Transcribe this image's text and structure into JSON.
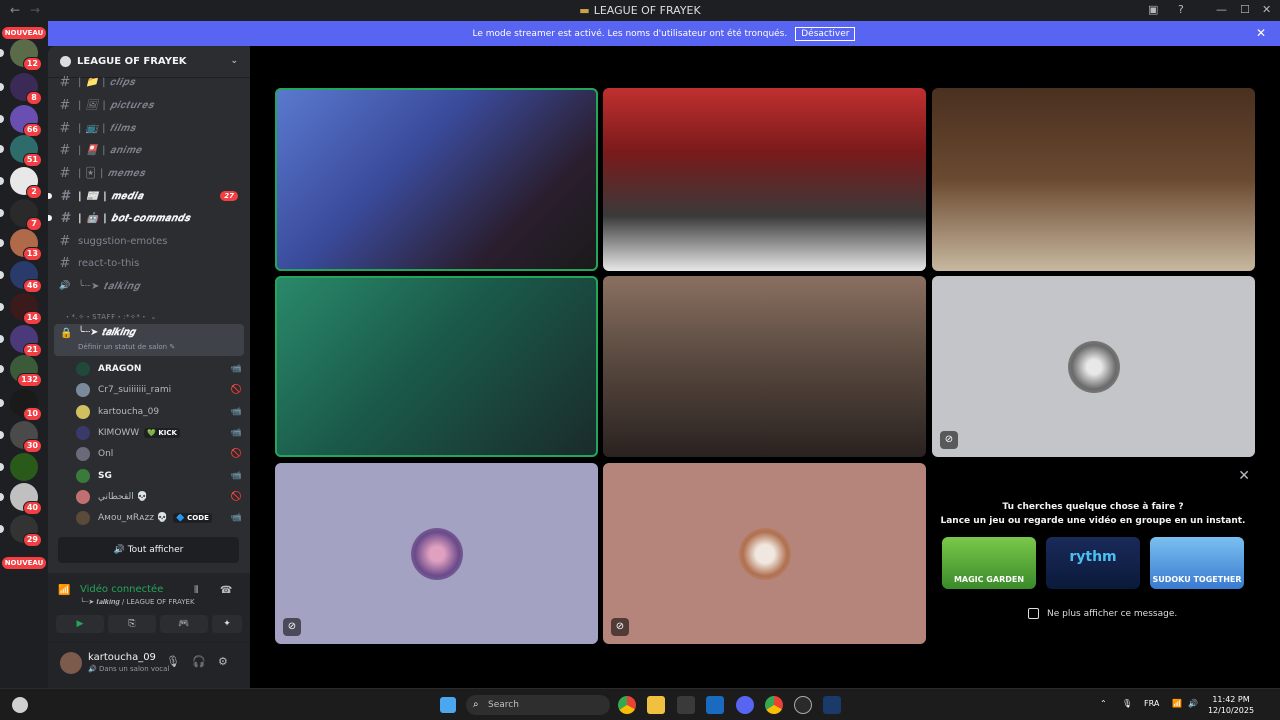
{
  "window": {
    "title": "LEAGUE OF FRAYEK",
    "back_icon": "arrow-left-icon",
    "forward_icon": "arrow-right-icon"
  },
  "banner": {
    "text": "Le mode streamer est activé. Les noms d'utilisateur ont été tronqués.",
    "button": "Désactiver"
  },
  "rail": {
    "new_label_top": "NOUVEAU",
    "new_label_bottom": "NOUVEAU",
    "servers": [
      {
        "badge": "12",
        "color": "#5a6b4a"
      },
      {
        "badge": "8",
        "color": "#3b2a55"
      },
      {
        "badge": "66",
        "color": "#6a4fb3"
      },
      {
        "badge": "51",
        "color": "#2e6b6b"
      },
      {
        "badge": "2",
        "color": "#e8e8e8"
      },
      {
        "badge": "7",
        "color": "#2a2a2a"
      },
      {
        "badge": "13",
        "color": "#b06a4a"
      },
      {
        "badge": "46",
        "color": "#2a3a6a"
      },
      {
        "badge": "14",
        "color": "#3a1a1a"
      },
      {
        "badge": "21",
        "color": "#4a3a7a"
      },
      {
        "badge": "132",
        "color": "#3a5a3a"
      },
      {
        "badge": "10",
        "color": "#1a1a1a"
      },
      {
        "badge": "30",
        "color": "#4a4a4a"
      },
      {
        "badge": "",
        "color": "#2a5a1a"
      },
      {
        "badge": "40",
        "color": "#c0c0c0"
      },
      {
        "badge": "29",
        "color": "#333333"
      }
    ]
  },
  "sidebar": {
    "server_name": "LEAGUE OF FRAYEK",
    "channels": [
      {
        "name": "| 📁 | 𝒄𝒍𝒊𝒑𝒔",
        "count": ""
      },
      {
        "name": "| 🖼 | 𝒑𝒊𝒄𝒕𝒖𝒓𝒆𝒔",
        "count": ""
      },
      {
        "name": "| 📺 | 𝒇𝒊𝒍𝒎𝒔",
        "count": ""
      },
      {
        "name": "| 🎴 | 𝒂𝒏𝒊𝒎𝒆",
        "count": ""
      },
      {
        "name": "| 🃏 | 𝒎𝒆𝒎𝒆𝒔",
        "count": ""
      },
      {
        "name": "| 📰 | 𝒎𝒆𝒅𝒊𝒂",
        "count": "27"
      },
      {
        "name": "| 🤖 | 𝒃𝒐𝒕-𝒄𝒐𝒎𝒎𝒂𝒏𝒅𝒔",
        "count": ""
      },
      {
        "name": "suggstion-emotes",
        "count": ""
      },
      {
        "name": "react-to-this",
        "count": ""
      },
      {
        "name": "╰┈➤ 𝒕𝒂𝒍𝒌𝒊𝒏𝒈",
        "count": ""
      }
    ],
    "staff_category": "・*.✧・STAFF・:*✧*・ ⌄",
    "active_channel": {
      "name": "╰┈➤ 𝒕𝒂𝒍𝒌𝒊𝒏𝒈",
      "status": "Définir un statut de salon ✎"
    },
    "voice_users": [
      {
        "name": "ARAGON",
        "tag": "",
        "right": "📹",
        "color": "#1f4a3a",
        "bold": true
      },
      {
        "name": "Cr7_suiiiiiii_rami",
        "tag": "",
        "right": "🚫",
        "color": "#7a8a9a",
        "bold": false
      },
      {
        "name": "kartoucha_09",
        "tag": "",
        "right": "📹",
        "color": "#d0c060",
        "bold": false
      },
      {
        "name": "KIMOWW",
        "tag": "💚 KICK",
        "right": "📹",
        "color": "#3a3a6a",
        "bold": false
      },
      {
        "name": "Onl",
        "tag": "",
        "right": "🚫",
        "color": "#6a6a7a",
        "bold": false
      },
      {
        "name": "SG",
        "tag": "",
        "right": "📹",
        "color": "#3a7a3a",
        "bold": true
      },
      {
        "name": "القحطاني 💀",
        "tag": "",
        "right": "🚫",
        "color": "#c07070",
        "bold": false
      },
      {
        "name": "Aᴍᴏᴜ_ᴍRᴀᴢᴢ 💀",
        "tag": "🔷 CODE",
        "right": "📹",
        "color": "#5a4a3a",
        "bold": false
      }
    ],
    "show_all": "🔊 Tout afficher",
    "voice_panel": {
      "status": "Vidéo connectée",
      "location": "╰┈➤ 𝒕𝒂𝒍𝒌𝒊𝒏𝒈 / LEAGUE OF FRAYEK"
    },
    "user": {
      "name": "kartoucha_09",
      "status": "🔊 Dans un salon vocal"
    }
  },
  "activity": {
    "line1": "Tu cherches quelque chose à faire ?",
    "line2": "Lance un jeu ou regarde une vidéo en groupe en un instant.",
    "games": [
      "MAGIC GARDEN",
      "rythm",
      "SUDOKU TOGETHER"
    ],
    "checkbox": "Ne plus afficher ce message."
  },
  "taskbar": {
    "search_placeholder": "Search",
    "lang": "FRA",
    "time": "11:42 PM",
    "date": "12/10/2025"
  }
}
